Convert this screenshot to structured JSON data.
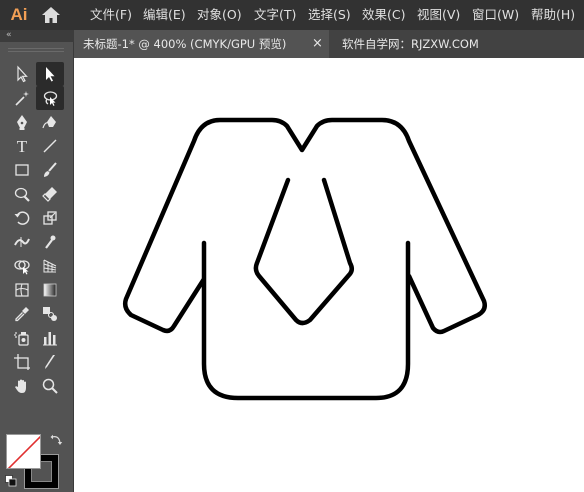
{
  "app": {
    "logo_text": "Ai",
    "accent_color": "#f29f55"
  },
  "menu": {
    "items": [
      "文件(F)",
      "编辑(E)",
      "对象(O)",
      "文字(T)",
      "选择(S)",
      "效果(C)",
      "视图(V)",
      "窗口(W)",
      "帮助(H)"
    ]
  },
  "tabs": {
    "active_label": "未标题-1* @ 400% (CMYK/GPU 预览)",
    "close_symbol": "×",
    "site_label": "软件自学网：RJZXW.COM"
  },
  "tools": {
    "collapse_symbol": "«",
    "type_glyph": "T",
    "icons": [
      "selection-icon",
      "direct-selection-icon",
      "magic-wand-icon",
      "lasso-icon",
      "pen-icon",
      "curvature-icon",
      "type-icon",
      "line-segment-icon",
      "rectangle-icon",
      "paintbrush-icon",
      "shaper-icon",
      "eraser-icon",
      "rotate-icon",
      "scale-icon",
      "width-icon",
      "puppet-warp-icon",
      "shape-builder-icon",
      "perspective-grid-icon",
      "mesh-icon",
      "gradient-icon",
      "eyedropper-icon",
      "blend-icon",
      "symbol-sprayer-icon",
      "column-graph-icon",
      "artboard-icon",
      "slice-icon",
      "hand-icon",
      "zoom-icon"
    ]
  },
  "colors": {
    "fill": "#ffffff",
    "stroke": "#000000",
    "none_indicator": "#e03030",
    "ui_dark": "#323232",
    "ui_panel": "#535353",
    "canvas": "#ffffff"
  }
}
